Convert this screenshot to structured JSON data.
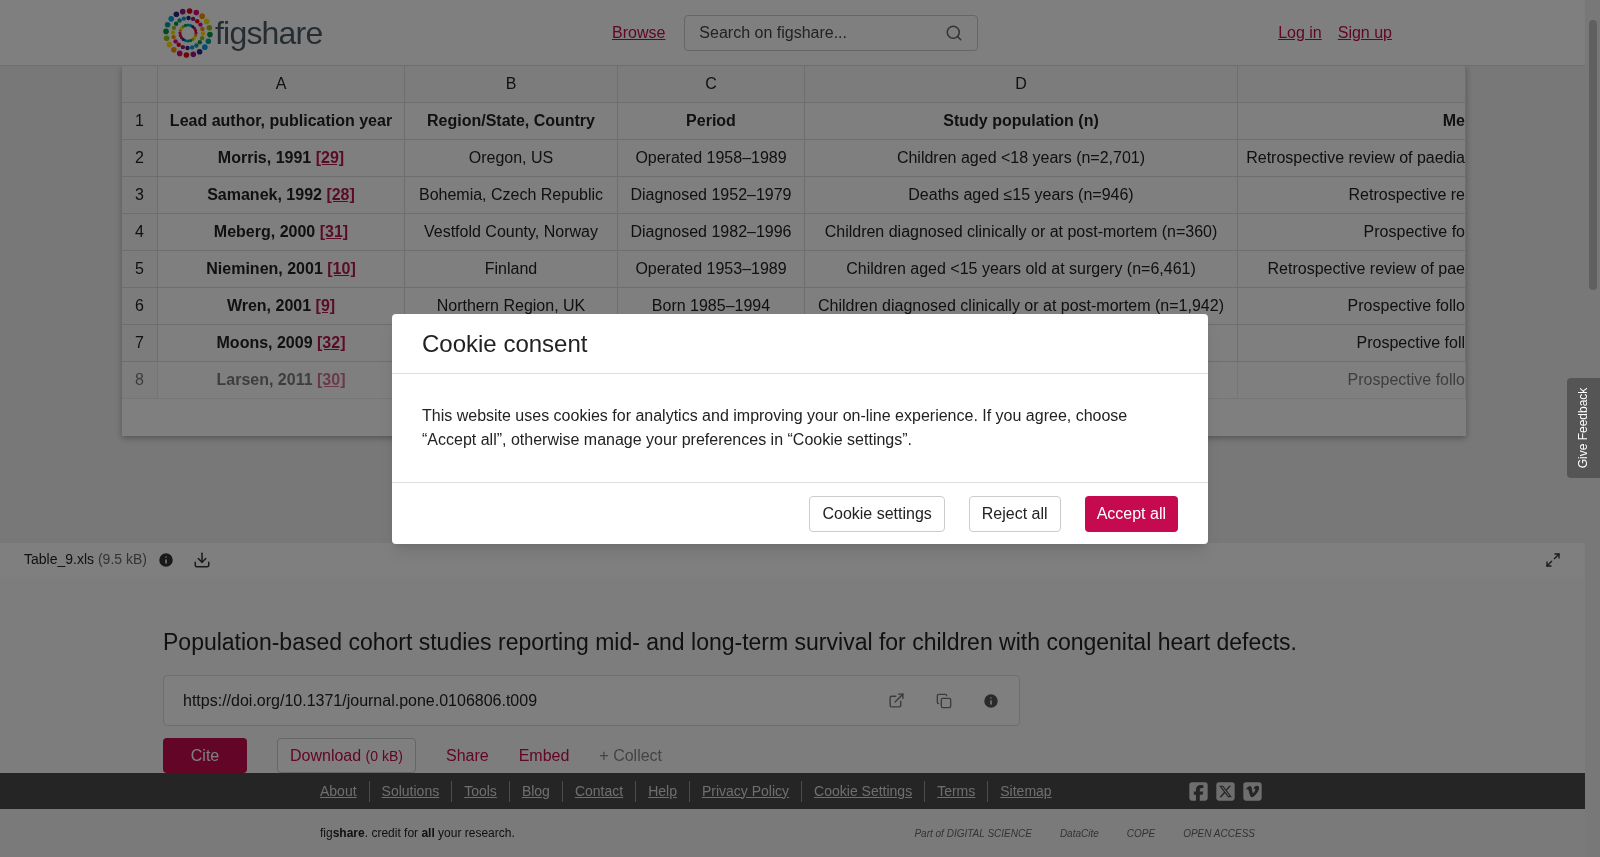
{
  "header": {
    "logo": "figshare",
    "nav_link": "Browse",
    "search": {
      "placeholder": "Search on figshare..."
    },
    "login": "Log in",
    "signup": "Sign up"
  },
  "spreadsheet": {
    "columns": [
      "A",
      "B",
      "C",
      "D"
    ],
    "rows": [
      {
        "number": "1",
        "kind": "header",
        "faded": false,
        "a": "Lead author, publication year",
        "b": "Region/State, Country",
        "c": "Period",
        "d": "Study population (n)",
        "e": "Me"
      },
      {
        "number": "2",
        "kind": "data",
        "faded": false,
        "a": "Morris, 1991",
        "a_ref": "[29]",
        "b": "Oregon, US",
        "c": "Operated 1958–1989",
        "d": "Children aged <18 years (n=2,701)",
        "e": "Retrospective review of paedia"
      },
      {
        "number": "3",
        "kind": "data",
        "faded": false,
        "a": "Samanek, 1992",
        "a_ref": "[28]",
        "b": "Bohemia, Czech Republic",
        "c": "Diagnosed 1952–1979",
        "d": "Deaths aged ≤15 years (n=946)",
        "e": "Retrospective re"
      },
      {
        "number": "4",
        "kind": "data",
        "faded": false,
        "a": "Meberg, 2000",
        "a_ref": "[31]",
        "b": "Vestfold County, Norway",
        "c": "Diagnosed 1982–1996",
        "d": "Children diagnosed clinically or at post-mortem (n=360)",
        "e": "Prospective fo"
      },
      {
        "number": "5",
        "kind": "data",
        "faded": false,
        "a": "Nieminen, 2001",
        "a_ref": "[10]",
        "b": "Finland",
        "c": "Operated 1953–1989",
        "d": "Children aged <15 years old at surgery (n=6,461)",
        "e": "Retrospective review of pae"
      },
      {
        "number": "6",
        "kind": "data",
        "faded": false,
        "a": "Wren, 2001",
        "a_ref": "[9]",
        "b": "Northern Region, UK",
        "c": "Born 1985–1994",
        "d": "Children diagnosed clinically or at post-mortem (n=1,942)",
        "e": "Prospective follo"
      },
      {
        "number": "7",
        "kind": "data",
        "faded": false,
        "a": "Moons, 2009",
        "a_ref": "[32]",
        "e": "Prospective foll"
      },
      {
        "number": "8",
        "kind": "data",
        "faded": true,
        "a": "Larsen, 2011",
        "a_ref": "[30]",
        "e": "Prospective follo"
      }
    ]
  },
  "file_bar": {
    "filename": "Table_9.xls",
    "size": "(9.5 kB)"
  },
  "item": {
    "title": "Population-based cohort studies reporting mid- and long-term survival for children with congenital heart defects.",
    "doi": "https://doi.org/10.1371/journal.pone.0106806.t009",
    "actions": [
      {
        "kind": "primary",
        "label": "Cite"
      },
      {
        "kind": "outline",
        "label": "Download",
        "note": "(0 kB)"
      },
      {
        "kind": "link",
        "label": "Share"
      },
      {
        "kind": "link",
        "label": "Embed"
      },
      {
        "kind": "muted",
        "label": "+ Collect"
      }
    ]
  },
  "footer": {
    "links": [
      "About",
      "Solutions",
      "Tools",
      "Blog",
      "Contact",
      "Help",
      "Privacy Policy",
      "Cookie Settings",
      "Terms",
      "Sitemap"
    ],
    "tagline": "fig**share**. credit for **all** your research.",
    "partners": [
      "Part of DIGITAL SCIENCE",
      "DataCite",
      "COPE",
      "OPEN ACCESS"
    ]
  },
  "feedback_tab": "Give Feedback",
  "cookie_dialog": {
    "title": "Cookie consent",
    "body": "This website uses cookies for analytics and improving your on-line experience. If you agree, choose “Accept all”, otherwise manage your preferences in “Cookie settings”.",
    "buttons": [
      {
        "kind": "secondary",
        "label": "Cookie settings"
      },
      {
        "kind": "secondary",
        "label": "Reject all"
      },
      {
        "kind": "primary",
        "label": "Accept all"
      }
    ]
  }
}
